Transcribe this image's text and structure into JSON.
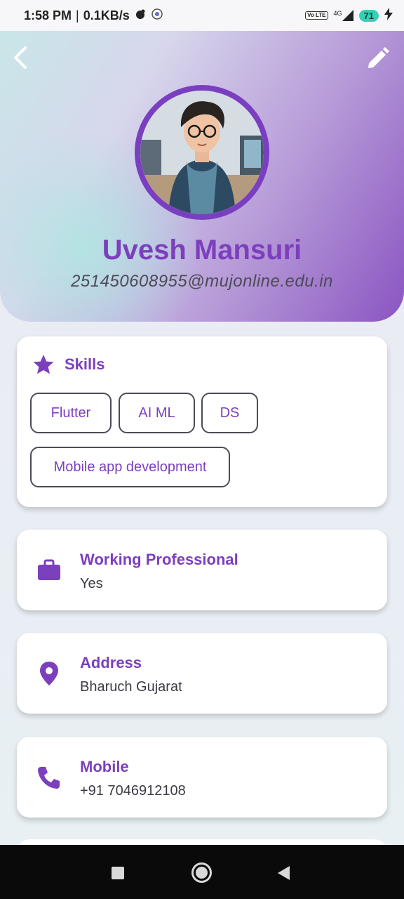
{
  "status_bar": {
    "time": "1:58 PM",
    "speed": "0.1KB/s",
    "network": "4G",
    "lte": "Vo LTE",
    "battery": "71"
  },
  "profile": {
    "name": "Uvesh Mansuri",
    "email": "251450608955@mujonline.edu.in"
  },
  "skills": {
    "title": "Skills",
    "chips": [
      "Flutter",
      "AI ML",
      "DS",
      "Mobile app development"
    ]
  },
  "info_cards": [
    {
      "title": "Working Professional",
      "value": "Yes",
      "icon": "briefcase-icon"
    },
    {
      "title": "Address",
      "value": "Bharuch Gujarat",
      "icon": "location-pin-icon"
    },
    {
      "title": "Mobile",
      "value": "+91 7046912108",
      "icon": "phone-icon"
    }
  ],
  "colors": {
    "accent": "#7c3fbd",
    "avatar_ring": "#7a3fc0",
    "battery": "#35d0b5"
  }
}
